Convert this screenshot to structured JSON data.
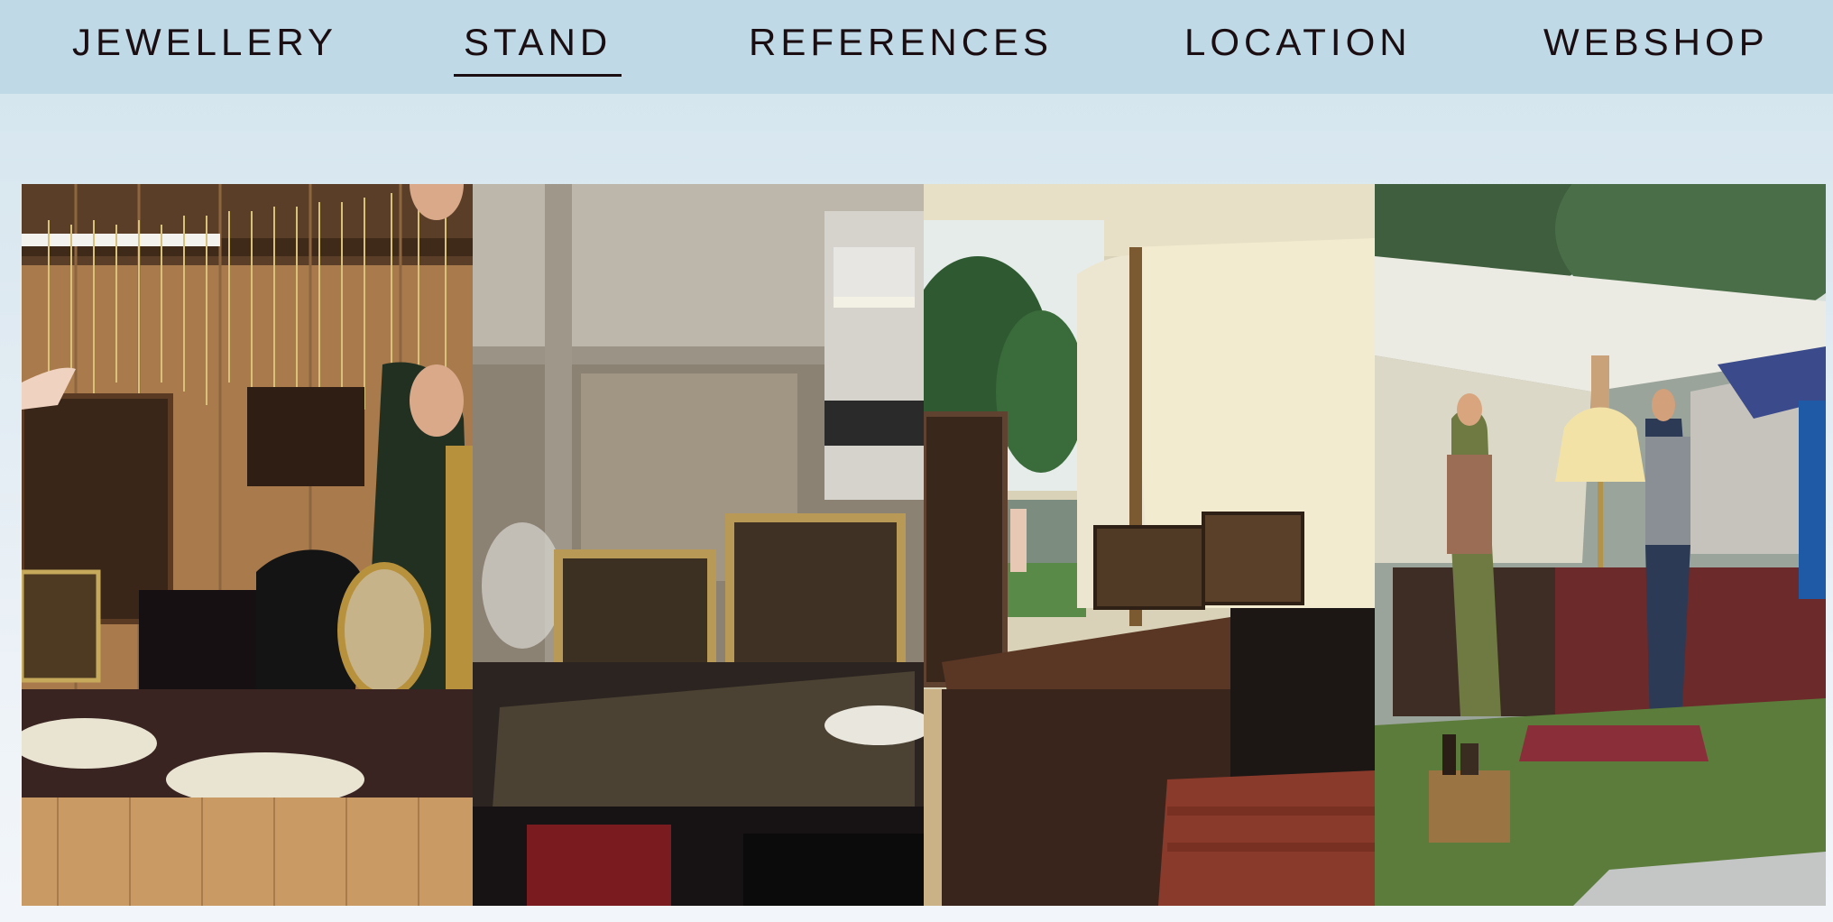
{
  "nav": {
    "items": [
      {
        "label": "JEWELLERY",
        "active": false
      },
      {
        "label": "STAND",
        "active": true
      },
      {
        "label": "REFERENCES",
        "active": false
      },
      {
        "label": "LOCATION",
        "active": false
      },
      {
        "label": "WEBSHOP",
        "active": false
      }
    ]
  },
  "gallery": {
    "photos": [
      {
        "subject": "indoor jewellery stand with hanging necklaces and mirror"
      },
      {
        "subject": "jewellery display table with framed earring boards"
      },
      {
        "subject": "canvas tent stand with framed displays and suitcases"
      },
      {
        "subject": "outdoor market tent stand with lamp and visitors"
      }
    ]
  },
  "colors": {
    "nav_background": "#bfdae6",
    "nav_text": "#1b0e12",
    "page_background": "#dde9f1"
  }
}
